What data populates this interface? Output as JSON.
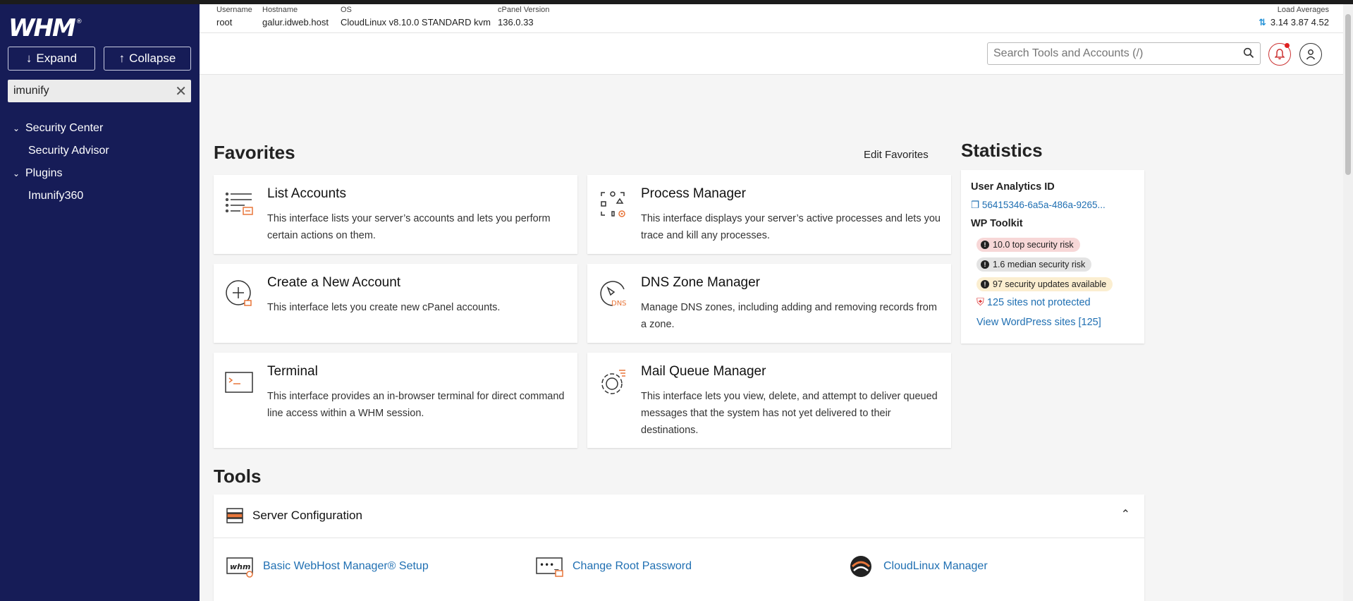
{
  "sidebar": {
    "logo": "WHM",
    "logo_mark": "®",
    "expand_label": "Expand",
    "collapse_label": "Collapse",
    "search_value": "imunify",
    "groups": [
      {
        "label": "Security Center",
        "items": [
          "Security Advisor"
        ]
      },
      {
        "label": "Plugins",
        "items": [
          "Imunify360"
        ]
      }
    ]
  },
  "header": {
    "username_label": "Username",
    "username": "root",
    "hostname_label": "Hostname",
    "hostname": "galur.idweb.host",
    "os_label": "OS",
    "os": "CloudLinux v8.10.0 STANDARD kvm",
    "cpanel_label": "cPanel Version",
    "cpanel": "136.0.33",
    "load_label": "Load Averages",
    "load": "3.14  3.87  4.52"
  },
  "toolbar": {
    "search_placeholder": "Search Tools and Accounts (/)"
  },
  "favorites": {
    "title": "Favorites",
    "edit_label": "Edit Favorites",
    "cards": [
      {
        "title": "List Accounts",
        "desc": "This interface lists your server’s accounts and lets you perform certain actions on them."
      },
      {
        "title": "Process Manager",
        "desc": "This interface displays your server’s active processes and lets you trace and kill any processes."
      },
      {
        "title": "Create a New Account",
        "desc": "This interface lets you create new cPanel accounts."
      },
      {
        "title": "DNS Zone Manager",
        "desc": "Manage DNS zones, including adding and removing records from a zone."
      },
      {
        "title": "Terminal",
        "desc": "This interface provides an in-browser terminal for direct command line access within a WHM session."
      },
      {
        "title": "Mail Queue Manager",
        "desc": "This interface lets you view, delete, and attempt to deliver queued messages that the system has not yet delivered to their destinations."
      }
    ]
  },
  "statistics": {
    "title": "Statistics",
    "analytics_label": "User Analytics ID",
    "analytics_id": "56415346-6a5a-486a-9265...",
    "wp_label": "WP Toolkit",
    "badges": [
      "10.0 top security risk",
      "1.6 median security risk",
      "97 security updates available"
    ],
    "not_protected": "125 sites not protected",
    "view_sites": "View WordPress sites [125]"
  },
  "tools": {
    "title": "Tools",
    "section": "Server Configuration",
    "items": [
      "Basic WebHost Manager® Setup",
      "Change Root Password",
      "CloudLinux Manager"
    ]
  },
  "colors": {
    "sidebar_bg": "#161c57",
    "link": "#1f6fb2",
    "accent_orange": "#e8763a"
  }
}
